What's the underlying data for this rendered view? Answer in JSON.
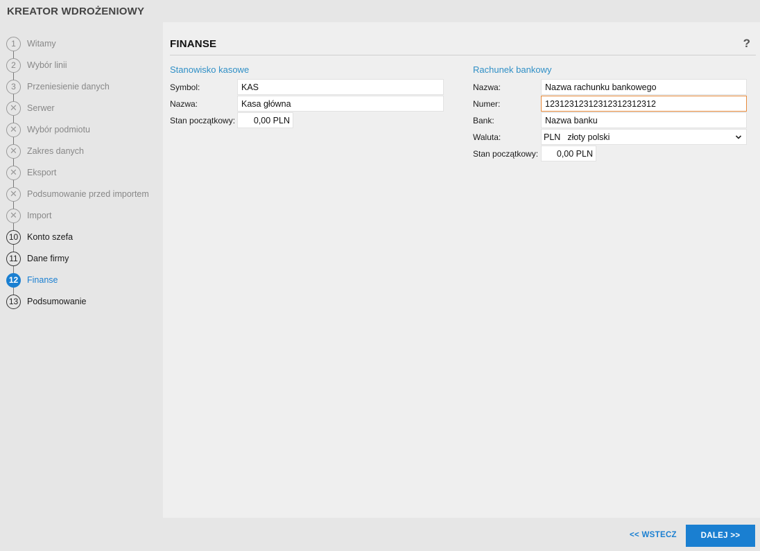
{
  "app": {
    "title": "KREATOR WDROŻENIOWY"
  },
  "steps": [
    {
      "marker": "1",
      "label": "Witamy",
      "state": "pending"
    },
    {
      "marker": "2",
      "label": "Wybór linii",
      "state": "pending"
    },
    {
      "marker": "3",
      "label": "Przeniesienie danych",
      "state": "pending"
    },
    {
      "marker": "✕",
      "label": "Serwer",
      "state": "skipped"
    },
    {
      "marker": "✕",
      "label": "Wybór podmiotu",
      "state": "skipped"
    },
    {
      "marker": "✕",
      "label": "Zakres danych",
      "state": "skipped"
    },
    {
      "marker": "✕",
      "label": "Eksport",
      "state": "skipped"
    },
    {
      "marker": "✕",
      "label": "Podsumowanie przed importem",
      "state": "skipped"
    },
    {
      "marker": "✕",
      "label": "Import",
      "state": "skipped"
    },
    {
      "marker": "10",
      "label": "Konto szefa",
      "state": "done"
    },
    {
      "marker": "11",
      "label": "Dane firmy",
      "state": "done"
    },
    {
      "marker": "12",
      "label": "Finanse",
      "state": "current"
    },
    {
      "marker": "13",
      "label": "Podsumowanie",
      "state": "done"
    }
  ],
  "panel": {
    "title": "FINANSE",
    "help": "?",
    "cash": {
      "title": "Stanowisko kasowe",
      "symbol_label": "Symbol:",
      "symbol_value": "KAS",
      "name_label": "Nazwa:",
      "name_value": "Kasa główna",
      "balance_label": "Stan początkowy:",
      "balance_value": "0,00 PLN"
    },
    "bank": {
      "title": "Rachunek bankowy",
      "name_label": "Nazwa:",
      "name_value": "Nazwa rachunku bankowego",
      "number_label": "Numer:",
      "number_value": "12312312312312312312312",
      "bank_label": "Bank:",
      "bank_value": "Nazwa banku",
      "currency_label": "Waluta:",
      "currency_code": "PLN",
      "currency_name": "złoty polski",
      "balance_label": "Stan początkowy:",
      "balance_value": "0,00 PLN"
    }
  },
  "footer": {
    "back_label": "<< WSTECZ",
    "next_label": "DALEJ >>"
  },
  "colors": {
    "accent": "#1a7fd1",
    "section_title": "#2f8fc6",
    "focus_border": "#e88a3a"
  }
}
